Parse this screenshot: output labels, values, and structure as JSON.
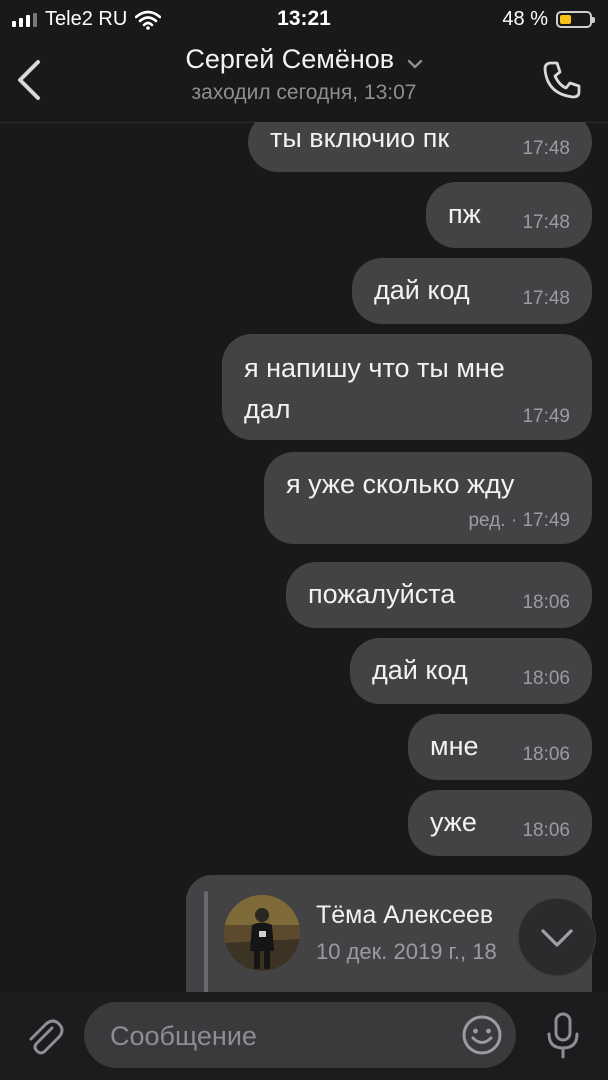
{
  "status_bar": {
    "carrier": "Tele2 RU",
    "time": "13:21",
    "battery_text": "48 %",
    "battery_level": 0.48,
    "battery_color": "#f6c316"
  },
  "header": {
    "contact_name": "Сергей Семёнов",
    "last_seen": "заходил сегодня, 13:07",
    "back_icon": "chevron-left-icon",
    "call_icon": "phone-icon"
  },
  "messages": [
    {
      "text": "ты включио пк",
      "time": "17:48"
    },
    {
      "text": "пж",
      "time": "17:48"
    },
    {
      "text": "дай код",
      "time": "17:48"
    },
    {
      "text": "я напишу что ты мне",
      "text2": "дал",
      "time": "17:49"
    },
    {
      "text": "я уже сколько жду",
      "time": "ред. · 17:49"
    },
    {
      "text": "пожалуйста",
      "time": "18:06"
    },
    {
      "text": "дай код",
      "time": "18:06"
    },
    {
      "text": "мне",
      "time": "18:06"
    },
    {
      "text": "уже",
      "time": "18:06"
    }
  ],
  "forwarded": {
    "author": "Тёма Алексеев",
    "date": "10 дек. 2019 г., 18"
  },
  "composer": {
    "placeholder": "Сообщение",
    "value": ""
  },
  "colors": {
    "background": "#19191a",
    "bubble": "#434345",
    "input": "#3a3a3c"
  }
}
